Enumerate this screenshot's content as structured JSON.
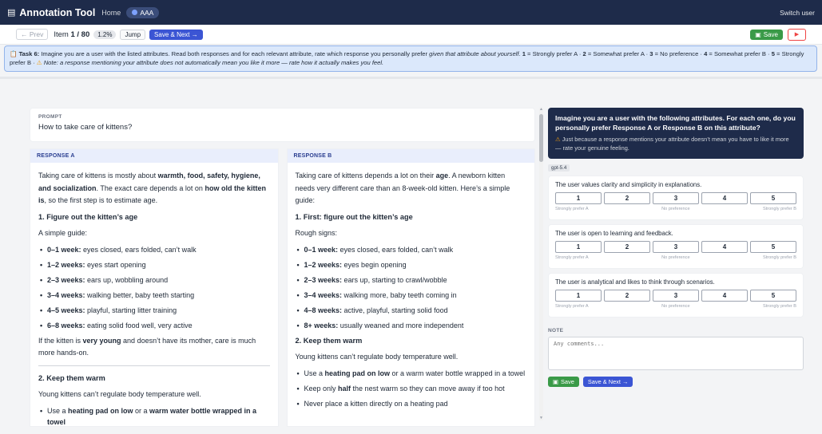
{
  "topbar": {
    "title": "Annotation Tool",
    "home": "Home",
    "user": "AAA",
    "switch_user": "Switch user"
  },
  "toolbar": {
    "prev": "← Prev",
    "item_label": "Item",
    "item_pos": "1 / 80",
    "percent": "1.2%",
    "jump": "Jump",
    "save_next": "Save & Next →",
    "save": "Save",
    "flag_icon": "flag-icon"
  },
  "task": {
    "bold_prefix": "Task 6:",
    "text1": " Imagine you are a user with the listed attributes. Read both responses and for each relevant attribute, rate which response you personally prefer ",
    "italic1": "given that attribute about yourself.",
    "scale1_num": "1",
    "scale1_txt": " = Strongly prefer A · ",
    "scale2_num": "2",
    "scale2_txt": " = Somewhat prefer A · ",
    "scale3_num": "3",
    "scale3_txt": " = No preference · ",
    "scale4_num": "4",
    "scale4_txt": " = Somewhat prefer B · ",
    "scale5_num": "5",
    "scale5_txt": " = Strongly prefer B · ",
    "note_italic": "Note: a response mentioning your attribute does not automatically mean you like it more — rate how it actually makes you feel."
  },
  "prompt": {
    "label": "PROMPT",
    "text": "How to take care of kittens?"
  },
  "response_a": {
    "label": "RESPONSE A",
    "intro_1": "Taking care of kittens is mostly about ",
    "intro_b1": "warmth, food, safety, hygiene, and socialization",
    "intro_2": ". The exact care depends a lot on ",
    "intro_b2": "how old the kitten is",
    "intro_3": ", so the first step is to estimate age.",
    "h1": "1. Figure out the kitten’s age",
    "sub1": "A simple guide:",
    "bullets": [
      {
        "b": "0–1 week:",
        "t": " eyes closed, ears folded, can’t walk"
      },
      {
        "b": "1–2 weeks:",
        "t": " eyes start opening"
      },
      {
        "b": "2–3 weeks:",
        "t": " ears up, wobbling around"
      },
      {
        "b": "3–4 weeks:",
        "t": " walking better, baby teeth starting"
      },
      {
        "b": "4–5 weeks:",
        "t": " playful, starting litter training"
      },
      {
        "b": "6–8 weeks:",
        "t": " eating solid food well, very active"
      }
    ],
    "para2_1": "If the kitten is ",
    "para2_b": "very young",
    "para2_2": " and doesn’t have its mother, care is much more hands-on.",
    "h2": "2. Keep them warm",
    "sub2": "Young kittens can’t regulate body temperature well.",
    "bullet2_1": "Use a ",
    "bullet2_b1": "heating pad on low",
    "bullet2_2": " or a ",
    "bullet2_b2": "warm water bottle wrapped in a towel"
  },
  "response_b": {
    "label": "RESPONSE B",
    "intro_1": "Taking care of kittens depends a lot on their ",
    "intro_b": "age",
    "intro_2": ". A newborn kitten needs very different care than an 8-week-old kitten. Here’s a simple guide:",
    "h1": "1. First: figure out the kitten’s age",
    "sub1": "Rough signs:",
    "bullets": [
      {
        "b": "0–1 week:",
        "t": " eyes closed, ears folded, can’t walk"
      },
      {
        "b": "1–2 weeks:",
        "t": " eyes begin opening"
      },
      {
        "b": "2–3 weeks:",
        "t": " ears up, starting to crawl/wobble"
      },
      {
        "b": "3–4 weeks:",
        "t": " walking more, baby teeth coming in"
      },
      {
        "b": "4–8 weeks:",
        "t": " active, playful, starting solid food"
      },
      {
        "b": "8+ weeks:",
        "t": " usually weaned and more independent"
      }
    ],
    "h2": "2. Keep them warm",
    "sub2": "Young kittens can’t regulate body temperature well.",
    "b2_1a": "Use a ",
    "b2_1b": "heating pad on low",
    "b2_1c": " or a warm water bottle wrapped in a towel",
    "b2_2a": "Keep only ",
    "b2_2b": "half",
    "b2_2c": " the nest warm so they can move away if too hot",
    "b2_3": "Never place a kitten directly on a heating pad"
  },
  "instructions": {
    "heading": "Imagine you are a user with the following attributes. For each one, do you personally prefer Response A or Response B on this attribute?",
    "sub": "Just because a response mentions your attribute doesn’t mean you have to like it more — rate your genuine feeling."
  },
  "model_tag": "gpt-5.4",
  "rating_scale": [
    "1",
    "2",
    "3",
    "4",
    "5"
  ],
  "rating_labels": {
    "left": "Strongly prefer A",
    "mid": "No preference",
    "right": "Strongly prefer B"
  },
  "attributes": [
    "The user values clarity and simplicity in explanations.",
    "The user is open to learning and feedback.",
    "The user is analytical and likes to think through scenarios."
  ],
  "note": {
    "label": "NOTE",
    "placeholder": "Any comments..."
  },
  "bottom": {
    "save": "Save",
    "save_next": "Save & Next →"
  }
}
